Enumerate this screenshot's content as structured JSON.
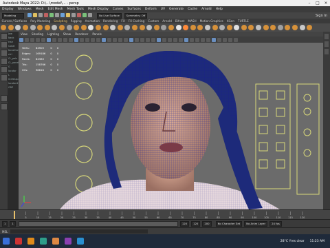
{
  "window": {
    "title": "Autodesk Maya 2022: D:\\...\\model\\... - persp"
  },
  "menubar": {
    "items": [
      "Display",
      "Windows",
      "Mesh",
      "Edit Mesh",
      "Mesh Tools",
      "Mesh Display",
      "Curves",
      "Surfaces",
      "Deform",
      "UV",
      "Generate",
      "Cache",
      "Arnold",
      "Help"
    ]
  },
  "statusline": {
    "mode": "Modeling",
    "live_surface": "No Live Surface",
    "symmetry": "Symmetry: Off",
    "sign_in": "Sign In"
  },
  "shelf": {
    "tabs": [
      "Curves / Surfaces",
      "Poly Modeling",
      "Sculpting",
      "Rigging",
      "Animation",
      "Rendering",
      "FX",
      "FX Caching",
      "Custom",
      "Arnold",
      "Bifrost",
      "MASH",
      "Motion Graphics",
      "XGen",
      "TURTLE"
    ],
    "selected_tab": "Sculpting"
  },
  "panel": {
    "menus": [
      "View",
      "Shading",
      "Lighting",
      "Show",
      "Renderer",
      "Panels"
    ],
    "camera": "persp"
  },
  "hud": {
    "rows": [
      {
        "label": "Verts:",
        "v1": "84903",
        "v2": "0",
        "v3": "0"
      },
      {
        "label": "Edges:",
        "v1": "169186",
        "v2": "0",
        "v3": "0"
      },
      {
        "label": "Faces:",
        "v1": "84383",
        "v2": "0",
        "v3": "0"
      },
      {
        "label": "Tris:",
        "v1": "158766",
        "v2": "0",
        "v3": "0"
      },
      {
        "label": "UVs:",
        "v1": "98816",
        "v2": "0",
        "v3": "0"
      }
    ]
  },
  "outliner": {
    "items": [
      "Jaw",
      "Neck",
      "Hair",
      "Collar",
      "facialControl",
      "ctrl",
      "CL_pelv",
      "CL_panelCtrl",
      "G",
      "locator",
      "L",
      "CtrlShape",
      "locator#1",
      "GRP"
    ]
  },
  "timeline": {
    "ticks": [
      "5",
      "10",
      "15",
      "20",
      "25",
      "30",
      "35",
      "40",
      "45",
      "50",
      "55",
      "60",
      "65",
      "70",
      "75",
      "80",
      "85",
      "90",
      "95",
      "100",
      "105",
      "110",
      "115",
      "120"
    ],
    "current_frame": "1"
  },
  "range": {
    "start": "1",
    "start_inner": "1",
    "end_inner": "120",
    "end": "120",
    "outer_end": "200",
    "character_set": "No Character Set",
    "anim_layer": "No Anim Layer",
    "fps": "24 fps"
  },
  "mel": {
    "label": "MEL"
  },
  "taskbar": {
    "weather": "28°C  Yres clear",
    "time": "11:23 AM"
  },
  "colors": {
    "accent": "#e8c06a",
    "viewport_bg": "#6b6b6b",
    "wire": "#1a1f8c"
  }
}
